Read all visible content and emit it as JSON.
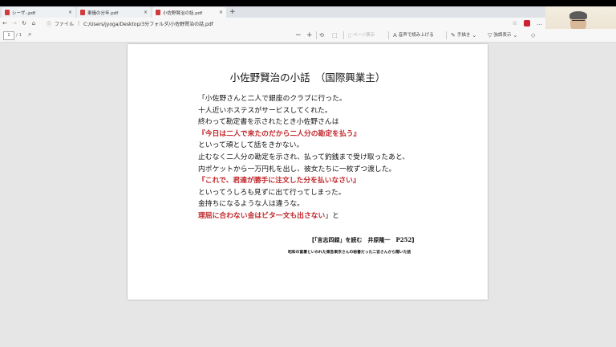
{
  "browser": {
    "tabs": [
      {
        "label": "シーザ-.pdf",
        "close": "×"
      },
      {
        "label": "東儀の分年.pdf",
        "close": "×"
      },
      {
        "label": "小佐野賢治の話.pdf",
        "close": "×"
      }
    ],
    "new_tab": "+",
    "address": {
      "info_icon": "ⓘ",
      "scheme_label": "ファイル",
      "separator": "|",
      "url": "C:/Users/jyoga/Desktop/3分フォルダ/小佐野賢治の話.pdf"
    }
  },
  "pdf_toolbar": {
    "page_current": "1",
    "page_total": "/ 1",
    "zoom_out": "−",
    "zoom_in": "+",
    "page_view_label": "ページ表示",
    "read_aloud_label": "音声で読み上げる",
    "draw_label": "手描き",
    "highlight_label": "強調表示"
  },
  "document": {
    "title": "小佐野賢治の小話　（国際興業主）",
    "lines": [
      {
        "text": "「小佐野さんと二人で銀座のクラブに行った。",
        "highlight": false
      },
      {
        "text": "十人近いホステスがサービスしてくれた。",
        "highlight": false
      },
      {
        "text": "終わって勘定書を示されたとき小佐野さんは",
        "highlight": false
      },
      {
        "text": "『今日は二人で来たのだから二人分の勘定を払う』",
        "highlight": true
      },
      {
        "text": "といって頑として話をきかない。",
        "highlight": false
      },
      {
        "text": "止むなく二人分の勘定を示され、払って釣銭まで受け取ったあと、",
        "highlight": false
      },
      {
        "text": "内ポケットから一万円札を出し、彼女たちに一枚ずつ渡した。",
        "highlight": false
      },
      {
        "text": "『これで、君達が勝手に注文した分を払いなさい』",
        "highlight": true
      },
      {
        "text": "といってうしろも見ずに出て行ってしまった。",
        "highlight": false
      },
      {
        "text": "金持ちになるような人は違うな。",
        "highlight": false
      }
    ],
    "last_line_red": "理屈に合わない金はビタ一文も出さない",
    "last_line_tail": "」と",
    "citation": "【「言志四録」を読む　井原隆一　P252】",
    "note": "昭和の富豪といわれた東急東京さんの秘書だった二宮さんから聞いた話"
  }
}
